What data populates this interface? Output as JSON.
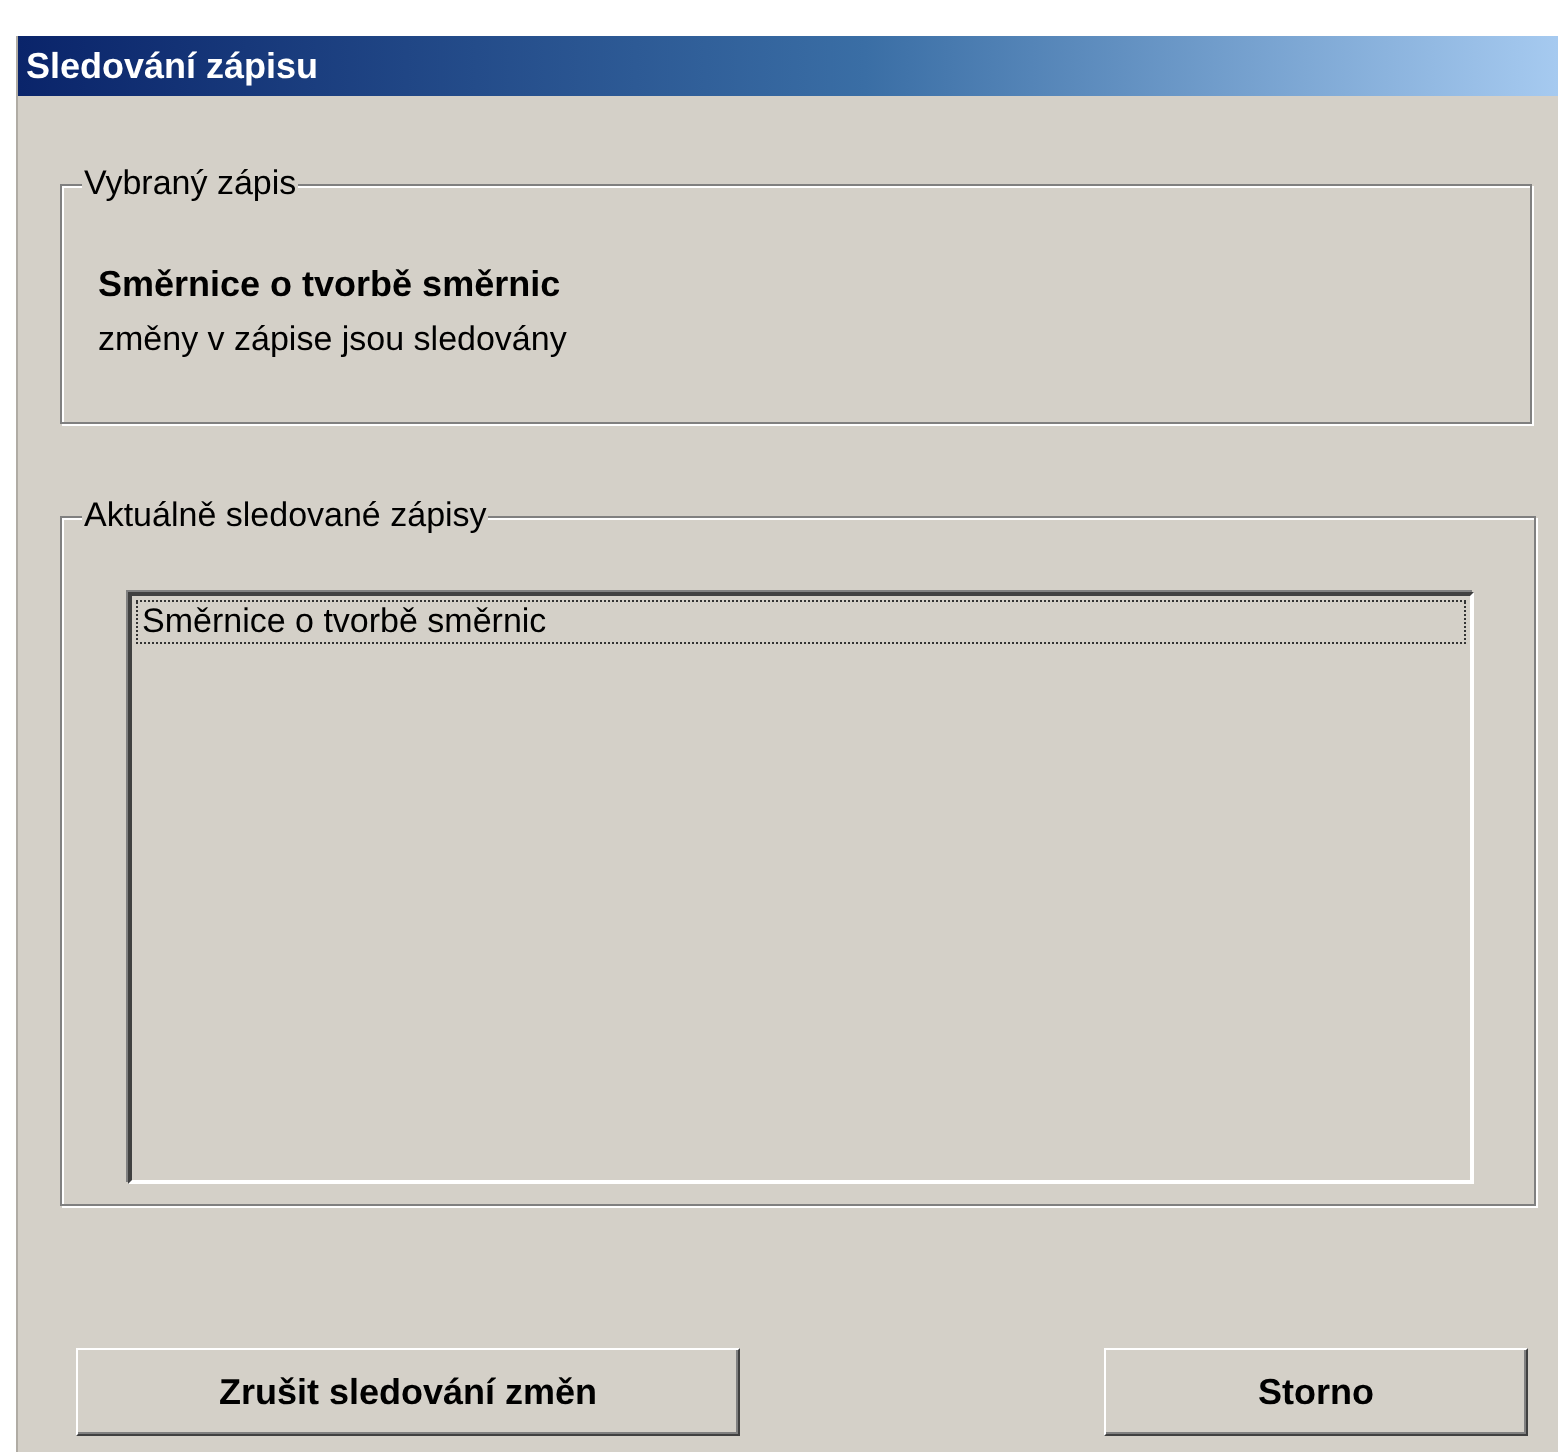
{
  "window": {
    "title": "Sledování zápisu"
  },
  "selected_entry": {
    "legend": "Vybraný zápis",
    "name": "Směrnice o tvorbě směrnic",
    "status": "změny v zápise jsou sledovány"
  },
  "watched": {
    "legend": "Aktuálně sledované zápisy",
    "items": [
      {
        "label": "Směrnice o tvorbě směrnic",
        "focused": true
      }
    ]
  },
  "buttons": [
    "Zrušit sledování změn",
    "Storno"
  ]
}
